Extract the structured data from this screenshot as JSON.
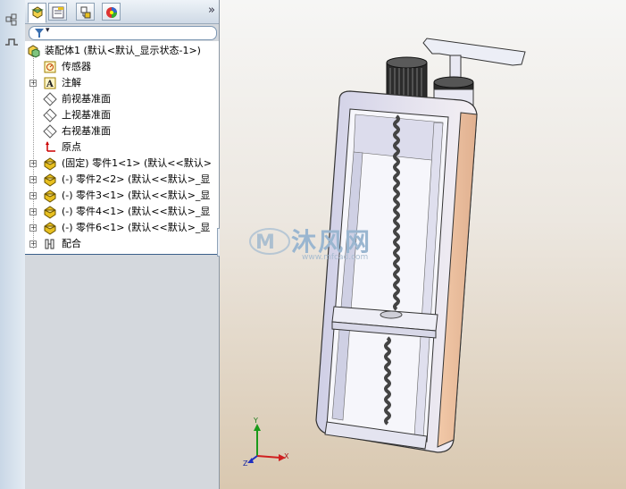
{
  "panel": {
    "tabs": [
      {
        "name": "featuremanager-icon",
        "active": true
      },
      {
        "name": "propertymanager-icon",
        "active": false
      },
      {
        "name": "configurationmanager-icon",
        "active": false
      },
      {
        "name": "appearance-icon",
        "active": false
      }
    ],
    "more_glyph": "»",
    "filter_glyph": "▾"
  },
  "tree": {
    "root": "装配体1  (默认<默认_显示状态-1>)",
    "items": [
      {
        "label": "传感器",
        "icon": "sensor-icon",
        "expandable": false
      },
      {
        "label": "注解",
        "icon": "annotation-icon",
        "expandable": true
      },
      {
        "label": "前视基准面",
        "icon": "plane-icon",
        "expandable": false
      },
      {
        "label": "上视基准面",
        "icon": "plane-icon",
        "expandable": false
      },
      {
        "label": "右视基准面",
        "icon": "plane-icon",
        "expandable": false
      },
      {
        "label": "原点",
        "icon": "origin-icon",
        "expandable": false
      },
      {
        "label": "(固定) 零件1<1> (默认<<默认>",
        "icon": "part-icon",
        "expandable": true
      },
      {
        "label": "(-) 零件2<2> (默认<<默认>_显",
        "icon": "part-icon",
        "expandable": true
      },
      {
        "label": "(-) 零件3<1> (默认<<默认>_显",
        "icon": "part-icon",
        "expandable": true
      },
      {
        "label": "(-) 零件4<1> (默认<<默认>_显",
        "icon": "part-icon",
        "expandable": true
      },
      {
        "label": "(-) 零件6<1> (默认<<默认>_显",
        "icon": "part-icon",
        "expandable": true
      },
      {
        "label": "配合",
        "icon": "mates-icon",
        "expandable": true
      }
    ]
  },
  "watermark": {
    "text": "沐风网",
    "url": "www.mfcad.com"
  },
  "triad": {
    "x": "X",
    "y": "Y",
    "z": "Z"
  },
  "colors": {
    "part_yellow": "#e8c020",
    "model_fill": "#e6e6f2",
    "model_edge": "#3a3a4a",
    "accent": "#3a5f8a"
  }
}
